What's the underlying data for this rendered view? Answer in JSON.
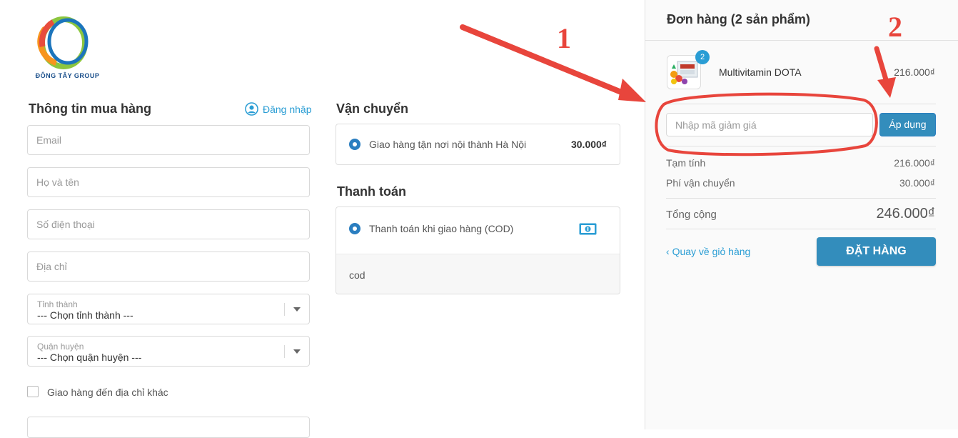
{
  "brand": {
    "logo_text": "ĐÔNG TÂY GROUP"
  },
  "checkout": {
    "buyer_info_title": "Thông tin mua hàng",
    "login_label": "Đăng nhập",
    "fields": {
      "email_placeholder": "Email",
      "name_placeholder": "Họ và tên",
      "phone_placeholder": "Số điện thoại",
      "address_placeholder": "Địa chỉ"
    },
    "province": {
      "label": "Tỉnh thành",
      "value": "--- Chọn tỉnh thành ---"
    },
    "district": {
      "label": "Quận huyện",
      "value": "--- Chọn quận huyện ---"
    },
    "ship_other_label": "Giao hàng đến địa chỉ khác"
  },
  "shipping": {
    "title": "Vận chuyển",
    "option_label": "Giao hàng tận nơi nội thành Hà Nội",
    "option_price": "30.000₫"
  },
  "payment": {
    "title": "Thanh toán",
    "option_label": "Thanh toán khi giao hàng (COD)",
    "details_text": "cod",
    "icon": "cash-icon"
  },
  "order": {
    "title": "Đơn hàng (2 sản phẩm)",
    "item": {
      "name": "Multivitamin DOTA",
      "qty": "2",
      "price": "216.000₫"
    },
    "discount_placeholder": "Nhập mã giảm giá",
    "apply_label": "Áp dụng",
    "subtotal_label": "Tạm tính",
    "subtotal_value": "216.000₫",
    "shipping_label": "Phí vận chuyển",
    "shipping_value": "30.000₫",
    "total_label": "Tổng cộng",
    "total_value": "246.000₫",
    "back_label": "Quay về giỏ hàng",
    "place_order_label": "ĐẶT HÀNG"
  },
  "annotations": {
    "marker_1": "1",
    "marker_2": "2",
    "color": "#e8453c"
  },
  "colors": {
    "accent": "#338dbc",
    "link": "#2a9dd4"
  }
}
